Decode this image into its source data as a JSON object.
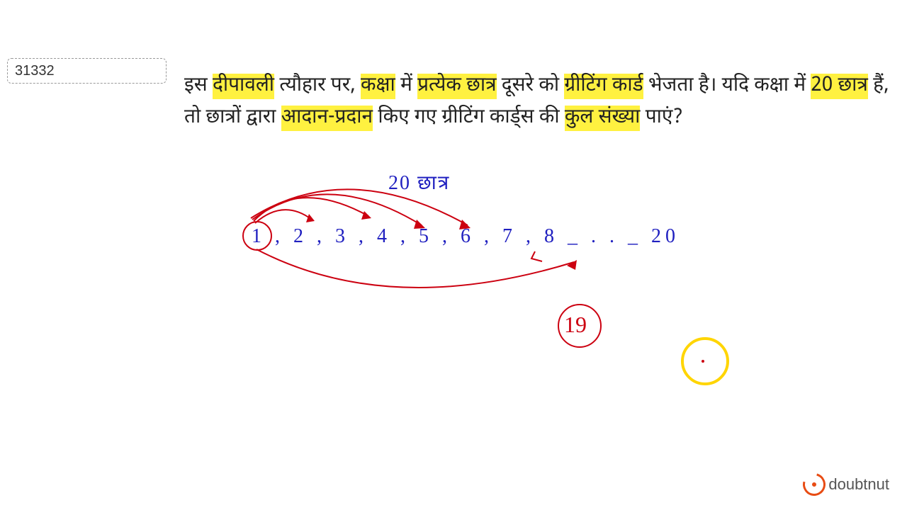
{
  "id_box": "31332",
  "question": {
    "pre1": "इस ",
    "hl1": "दीपावली",
    "mid1": " त्यौहार पर, ",
    "hl2": "कक्षा",
    "mid2": " में ",
    "hl3": "प्रत्येक छात्र",
    "mid3": " दूसरे को ",
    "hl4": "ग्रीटिंग कार्ड",
    "mid4": " भेजता है। यदि कक्षा में ",
    "hl5": "20 छात्र",
    "mid5": " हैं, तो छात्रों द्वारा ",
    "hl6": "आदान-प्रदान",
    "mid6": " किए गए ग्रीटिंग कार्ड्स की ",
    "hl7": "कुल संख्या",
    "mid7": " पाएं?"
  },
  "annotations": {
    "header": "20  छात्र",
    "numbers": "1   ,  2     ,   3   , 4 ,  5    ,  6  , 7  ,  8  _  . . _  20",
    "result": "19"
  },
  "logo_text": "doubtnut"
}
